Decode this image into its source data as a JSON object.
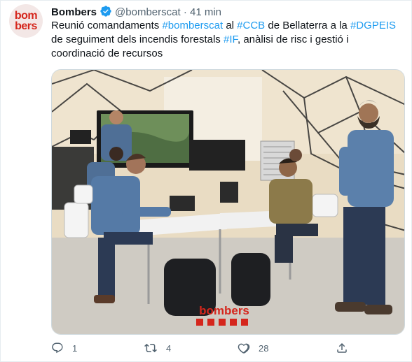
{
  "tweet": {
    "avatar_text_line1": "bom",
    "avatar_text_line2": "bers",
    "author_name": "Bombers",
    "handle": "@bomberscat",
    "separator": "·",
    "time": "41 min",
    "text_parts": [
      {
        "text": "Reunió comandaments ",
        "type": "text"
      },
      {
        "text": "#bomberscat",
        "type": "hashtag"
      },
      {
        "text": " al ",
        "type": "text"
      },
      {
        "text": "#CCB",
        "type": "hashtag"
      },
      {
        "text": " de Bellaterra a la ",
        "type": "text"
      },
      {
        "text": "#DGPEIS",
        "type": "hashtag"
      },
      {
        "text": " de seguiment dels incendis forestals ",
        "type": "text"
      },
      {
        "text": "#IF",
        "type": "hashtag"
      },
      {
        "text": ", anàlisi de risc i gestió i coordinació de recursos",
        "type": "text"
      }
    ],
    "media_watermark": "bombers"
  },
  "actions": {
    "reply_icon": "reply-icon",
    "reply_count": "1",
    "retweet_icon": "retweet-icon",
    "retweet_count": "4",
    "like_icon": "heart-icon",
    "like_count": "28",
    "share_icon": "share-icon"
  },
  "colors": {
    "hashtag": "#1d9bf0",
    "secondary_text": "#536471",
    "brand_red": "#d5261c",
    "verified": "#1d9bf0"
  }
}
